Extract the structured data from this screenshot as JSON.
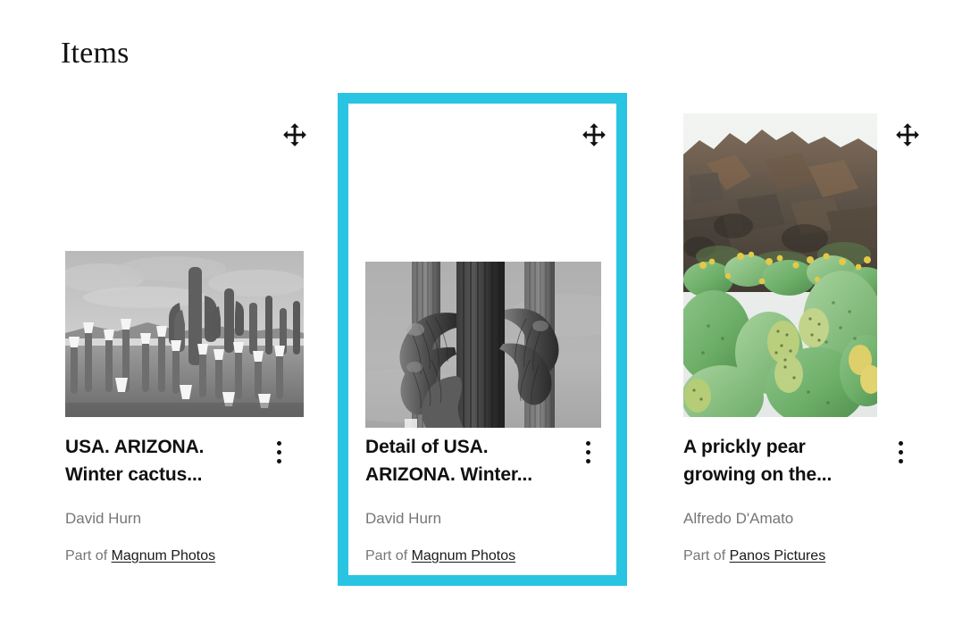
{
  "page": {
    "title": "Items",
    "background": "#ffffff",
    "selection_color": "#2ac4e3",
    "muted_text_color": "#767676"
  },
  "icons": {
    "drag_handle": "move-icon",
    "kebab": "more-options-icon"
  },
  "items": [
    {
      "title": "USA. ARIZONA. Winter cactus...",
      "creator": "David Hurn",
      "source_prefix": "Part of ",
      "source_link": "Magnum Photos",
      "selected": false,
      "thumbnail": {
        "alt": "Black and white photograph of a field of saguaro and other cacti with white styrofoam cups placed on their tips under a cloudy Arizona sky",
        "palette": "grayscale"
      }
    },
    {
      "title": "Detail of USA. ARIZONA. Winter...",
      "creator": "David Hurn",
      "source_prefix": "Part of ",
      "source_link": "Magnum Photos",
      "selected": true,
      "thumbnail": {
        "alt": "Black and white close-up photograph of the ribbed arms of a saguaro cactus against a pale grey sky",
        "palette": "grayscale"
      }
    },
    {
      "title": "A prickly pear growing on the...",
      "creator": "Alfredo D'Amato",
      "source_prefix": "Part of ",
      "source_link": "Panos Pictures",
      "selected": false,
      "thumbnail": {
        "alt": "Colour photograph of green prickly pear cactus pads with yellow fruit growing in front of dark brown volcanic rock",
        "palette": "color"
      }
    }
  ]
}
